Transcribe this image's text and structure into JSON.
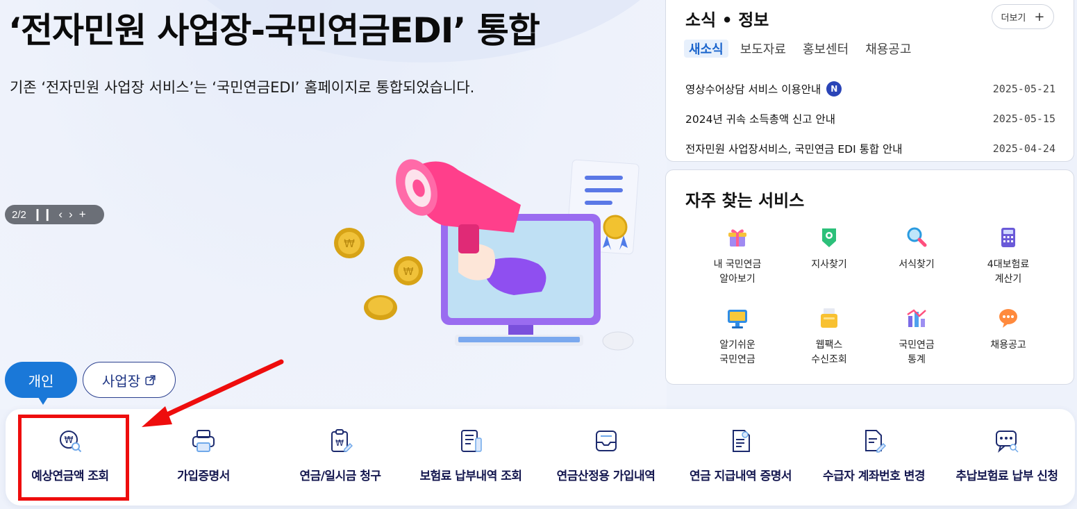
{
  "hero": {
    "title": "‘전자민원 사업장-국민연금EDI’ 통합",
    "subtitle": "기존 ‘전자민원 사업장 서비스’는 ‘국민연금EDI’ 홈페이지로 통합되었습니다.",
    "slide_indicator": "2/2"
  },
  "user_tabs": {
    "personal": "개인",
    "business": "사업장"
  },
  "quick_menu": [
    {
      "label": "예상연금액 조회",
      "icon": "pension-search-icon"
    },
    {
      "label": "가입증명서",
      "icon": "printer-icon"
    },
    {
      "label": "연금/일시금 청구",
      "icon": "clipboard-won-icon"
    },
    {
      "label": "보험료 납부내역 조회",
      "icon": "receipt-icon"
    },
    {
      "label": "연금산정용 가입내역",
      "icon": "inbox-tray-icon"
    },
    {
      "label": "연금 지급내역 증명서",
      "icon": "certificate-doc-icon"
    },
    {
      "label": "수급자 계좌번호 변경",
      "icon": "doc-edit-icon"
    },
    {
      "label": "추납보험료 납부 신청",
      "icon": "chat-search-icon"
    }
  ],
  "news": {
    "title": "소식 • 정보",
    "more_label": "더보기",
    "tabs": [
      "새소식",
      "보도자료",
      "홍보센터",
      "채용공고"
    ],
    "active_tab": "새소식",
    "items": [
      {
        "title": "영상수어상담 서비스 이용안내",
        "date": "2025-05-21",
        "new_badge": "N"
      },
      {
        "title": "2024년 귀속 소득총액 신고 안내",
        "date": "2025-05-15"
      },
      {
        "title": "전자민원 사업장서비스, 국민연금 EDI 통합 안내",
        "date": "2025-04-24"
      }
    ]
  },
  "services": {
    "title": "자주 찾는 서비스",
    "items": [
      {
        "label": "내 국민연금\n알아보기",
        "icon": "gift-icon"
      },
      {
        "label": "지사찾기",
        "icon": "map-pin-icon"
      },
      {
        "label": "서식찾기",
        "icon": "magnifier-icon"
      },
      {
        "label": "4대보험료\n계산기",
        "icon": "calculator-icon"
      },
      {
        "label": "알기쉬운\n국민연금",
        "icon": "monitor-icon"
      },
      {
        "label": "웹팩스\n수신조회",
        "icon": "fax-icon"
      },
      {
        "label": "국민연금\n통계",
        "icon": "chart-icon"
      },
      {
        "label": "채용공고",
        "icon": "speech-bubble-icon"
      }
    ]
  },
  "colors": {
    "accent": "#1a78d8",
    "navy": "#14174f",
    "highlight": "#ee0d0d"
  }
}
